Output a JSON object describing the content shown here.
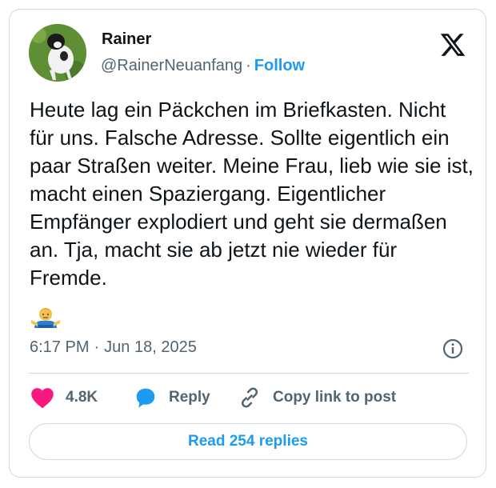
{
  "author": {
    "name": "Rainer",
    "handle": "@RainerNeuanfang",
    "separator": "·",
    "follow_label": "Follow"
  },
  "tweet": {
    "text": "Heute lag ein Päckchen im Briefkasten. Nicht für uns. Falsche Adresse. Sollte eigentlich ein paar Straßen weiter. Meine Frau, lieb wie sie ist, macht einen Spaziergang. Eigentlicher Empfänger explodiert und geht sie dermaßen an. Tja, macht sie ab jetzt nie wieder für Fremde.",
    "emoji": "man-shrugging",
    "time": "6:17 PM",
    "meta_separator": "·",
    "date": "Jun 18, 2025"
  },
  "actions": {
    "like_count": "4.8K",
    "reply_label": "Reply",
    "copy_label": "Copy link to post"
  },
  "read_replies_label": "Read 254 replies",
  "colors": {
    "accent": "#1d9bf0",
    "like": "#f91880",
    "text": "#0f1419",
    "muted": "#536471",
    "border": "#cfd9de"
  },
  "icons": [
    "x-logo-icon",
    "info-icon",
    "heart-icon",
    "reply-bubble-icon",
    "link-icon"
  ]
}
